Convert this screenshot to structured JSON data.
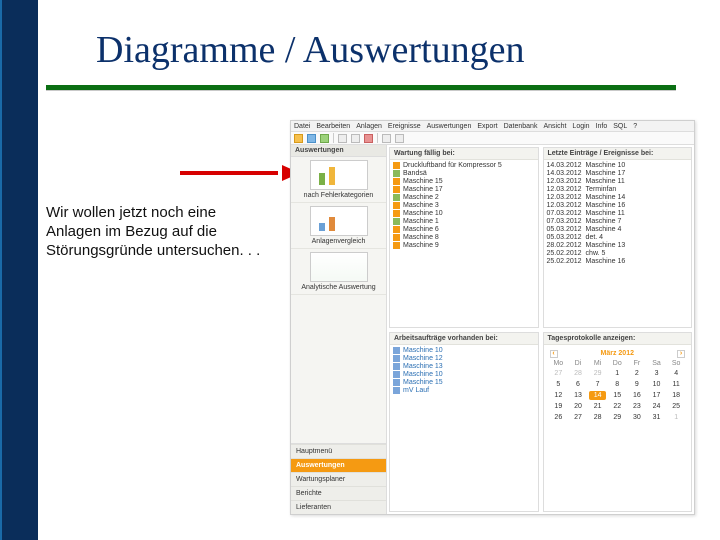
{
  "slide": {
    "title": "Diagramme / Auswertungen",
    "body_text": "Wir  wollen jetzt noch eine Anlagen im Bezug auf die Störungsgründe untersuchen. . ."
  },
  "app": {
    "menu": [
      "Datei",
      "Bearbeiten",
      "Anlagen",
      "Ereignisse",
      "Auswertungen",
      "Export",
      "Datenbank",
      "Ansicht",
      "Login",
      "Info",
      "SQL",
      "?"
    ],
    "sidebar": {
      "section_label": "Auswertungen",
      "blocks": [
        {
          "label": "nach Fehlerkategorien",
          "thumb": "chart"
        },
        {
          "label": "Anlagenvergleich",
          "thumb": "chart2"
        },
        {
          "label": "Analytische Auswertung",
          "thumb": "report"
        }
      ],
      "nav": [
        {
          "label": "Hauptmenü",
          "active": false
        },
        {
          "label": "Auswertungen",
          "active": true
        },
        {
          "label": "Wartungsplaner",
          "active": false
        },
        {
          "label": "Berichte",
          "active": false
        },
        {
          "label": "Lieferanten",
          "active": false
        }
      ]
    },
    "panels": {
      "wartung": {
        "title": "Wartung fällig bei:",
        "items": [
          {
            "ico": "or",
            "label": "Druckluftband für Kompressor 5"
          },
          {
            "ico": "gr",
            "label": "Bandsä"
          },
          {
            "ico": "or",
            "label": "Maschine 15"
          },
          {
            "ico": "or",
            "label": "Maschine 17"
          },
          {
            "ico": "gr",
            "label": "Maschine 2"
          },
          {
            "ico": "or",
            "label": "Maschine 3"
          },
          {
            "ico": "or",
            "label": "Maschine 10"
          },
          {
            "ico": "gr",
            "label": "Maschine 1"
          },
          {
            "ico": "or",
            "label": "Maschine 6"
          },
          {
            "ico": "or",
            "label": "Maschine 8"
          },
          {
            "ico": "or",
            "label": "Maschine 9"
          }
        ]
      },
      "events": {
        "title": "Letzte Einträge / Ereignisse bei:",
        "items": [
          {
            "ts": "14.03.2012",
            "label": "Maschine 10"
          },
          {
            "ts": "14.03.2012",
            "label": "Maschine 17"
          },
          {
            "ts": "12.03.2012",
            "label": "Maschine 11"
          },
          {
            "ts": "12.03.2012",
            "label": "Terminfan"
          },
          {
            "ts": "12.03.2012",
            "label": "Maschine 14"
          },
          {
            "ts": "12.03.2012",
            "label": "Maschine 16"
          },
          {
            "ts": "07.03.2012",
            "label": "Maschine 11"
          },
          {
            "ts": "07.03.2012",
            "label": "Maschine 7"
          },
          {
            "ts": "05.03.2012",
            "label": "Maschine 4"
          },
          {
            "ts": "05.03.2012",
            "label": "det. 4"
          },
          {
            "ts": "28.02.2012",
            "label": "Maschine 13"
          },
          {
            "ts": "25.02.2012",
            "label": "chw. 5"
          },
          {
            "ts": "25.02.2012",
            "label": "Maschine 16"
          }
        ]
      },
      "tasks": {
        "title": "Arbeitsaufträge vorhanden bei:",
        "items": [
          {
            "label": "Maschine 10"
          },
          {
            "label": "Maschine 12"
          },
          {
            "label": "Maschine 13"
          },
          {
            "label": "Maschine 10"
          },
          {
            "label": "Maschine 15"
          },
          {
            "label": "mV Lauf"
          }
        ]
      },
      "calendar": {
        "title": "Tagesprotokolle anzeigen:",
        "month": "März 2012",
        "dow": [
          "Mo",
          "Di",
          "Mi",
          "Do",
          "Fr",
          "Sa",
          "So"
        ],
        "today": 14,
        "lead_dim": [
          27,
          28,
          29
        ],
        "days": [
          1,
          2,
          3,
          4,
          5,
          6,
          7,
          8,
          9,
          10,
          11,
          12,
          13,
          14,
          15,
          16,
          17,
          18,
          19,
          20,
          21,
          22,
          23,
          24,
          25,
          26,
          27,
          28,
          29,
          30,
          31
        ],
        "trail_dim": [
          1
        ]
      }
    }
  }
}
